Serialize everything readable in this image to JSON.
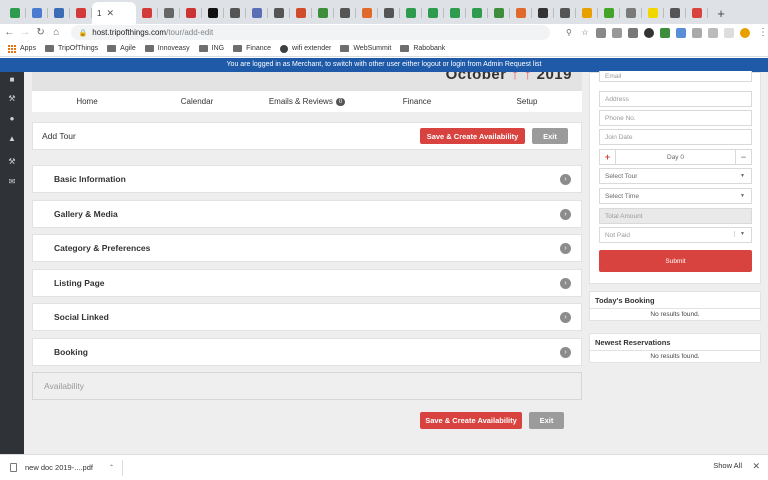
{
  "browser": {
    "active_tab_title": "1",
    "tab_favicon_colors": [
      "#2e9b4e",
      "#4a7bd0",
      "#3b6cb5",
      "#d33b3b",
      "#d33b3b",
      "#666666",
      "#c33",
      "#111111",
      "#555555",
      "#5b6fb5",
      "#555555",
      "#d04c2b",
      "#3c8d3c",
      "#555555",
      "#e06a2b",
      "#555555",
      "#2e9b4e",
      "#2e9b4e",
      "#2e9b4e",
      "#2e9b4e",
      "#3c8d3c",
      "#e06a2b",
      "#333333",
      "#555555",
      "#e8a000",
      "#42a52a",
      "#7a7a7a",
      "#f2d600",
      "#555555",
      "#d9433f"
    ],
    "url_host": "host.tripofthings.com",
    "url_path": "/tour/add-edit",
    "bookmarks": [
      {
        "label": "Apps",
        "icon": "apps-grid-icon"
      },
      {
        "label": "TripOfThings",
        "icon": "folder-icon"
      },
      {
        "label": "Agile",
        "icon": "folder-icon"
      },
      {
        "label": "Innoveasy",
        "icon": "folder-icon"
      },
      {
        "label": "ING",
        "icon": "folder-icon"
      },
      {
        "label": "Finance",
        "icon": "folder-icon"
      },
      {
        "label": "wifi extender",
        "icon": "globe-icon"
      },
      {
        "label": "WebSummit",
        "icon": "folder-icon"
      },
      {
        "label": "Rabobank",
        "icon": "folder-icon"
      }
    ]
  },
  "banner": {
    "text": "You are logged in as Merchant, to switch with other user either logout or login from Admin Request list"
  },
  "header": {
    "month": "October",
    "year": "2019"
  },
  "nav": {
    "home": "Home",
    "calendar": "Calendar",
    "emails": "Emails & Reviews",
    "emails_badge": "0",
    "finance": "Finance",
    "setup": "Setup"
  },
  "add_tour": {
    "title": "Add Tour",
    "save_label": "Save & Create Availability",
    "exit_label": "Exit"
  },
  "sections": {
    "basic": "Basic Information",
    "gallery": "Gallery & Media",
    "category": "Category & Preferences",
    "listing": "Listing Page",
    "social": "Social Linked",
    "booking": "Booking",
    "availability": "Availability"
  },
  "booking_form": {
    "email_placeholder": "Email",
    "address_placeholder": "Address",
    "phone_placeholder": "Phone No.",
    "join_date_placeholder": "Join Date",
    "day_value": "Day 0",
    "select_tour": "Select Tour",
    "select_time": "Select Time",
    "total_amount": "Total Amount",
    "payment_status": "Not Paid",
    "submit_label": "Submit"
  },
  "todays_booking": {
    "title": "Today's Booking",
    "empty": "No results found."
  },
  "newest_reservations": {
    "title": "Newest Reservations",
    "empty": "No results found."
  },
  "downloads": {
    "file_name": "new doc 2019-....pdf",
    "show_all": "Show All"
  },
  "colors": {
    "accent_red": "#d9433f",
    "banner_blue": "#1e5aa8",
    "sidebar_dark": "#2f3236"
  }
}
